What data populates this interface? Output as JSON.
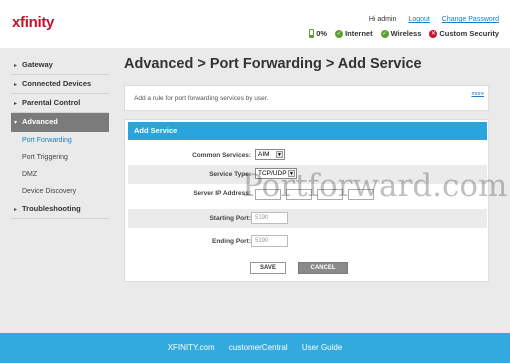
{
  "brand": {
    "logo": "xfinity",
    "accent": "#c8102e",
    "footer_bg": "#33aade",
    "header_bg": "#29a4dc"
  },
  "header": {
    "greeting": "Hi admin",
    "logout": "Logout",
    "change_password": "Change Password",
    "status": {
      "battery": "0%",
      "internet": "Internet",
      "wireless": "Wireless",
      "security": "Custom Security"
    }
  },
  "sidebar": {
    "items": [
      {
        "label": "Gateway",
        "icon": "chevron-right-icon"
      },
      {
        "label": "Connected Devices",
        "icon": "chevron-right-icon"
      },
      {
        "label": "Parental Control",
        "icon": "chevron-right-icon"
      },
      {
        "label": "Advanced",
        "icon": "chevron-down-icon"
      },
      {
        "label": "Troubleshooting",
        "icon": "chevron-right-icon"
      }
    ],
    "subitems": [
      "Port Forwarding",
      "Port Triggering",
      "DMZ",
      "Device Discovery"
    ]
  },
  "main": {
    "title": "Advanced > Port Forwarding > Add Service",
    "description": "Add a rule for port forwarding services by user.",
    "more_link": "more",
    "form": {
      "header": "Add Service",
      "common_services_label": "Common Services:",
      "common_services_value": "AIM",
      "service_type_label": "Service Type:",
      "service_type_value": "TCP/UDP",
      "server_ip_label": "Server IP Address:",
      "starting_port_label": "Starting Port:",
      "starting_port_placeholder": "5190",
      "ending_port_label": "Ending Port:",
      "ending_port_placeholder": "5190",
      "save": "SAVE",
      "cancel": "CANCEL"
    }
  },
  "watermark": "Portforward.com",
  "footer": {
    "links": [
      "XFINITY.com",
      "customerCentral",
      "User Guide"
    ]
  }
}
